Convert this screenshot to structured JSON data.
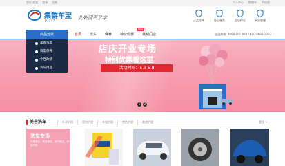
{
  "topbar": {
    "links_left": [
      "您好,欢迎",
      "登录",
      "注册"
    ],
    "links_right": [
      "个人中心",
      "购物车",
      "手机版"
    ]
  },
  "header": {
    "brand": "集群车宝",
    "brand_sub": "JIQUN",
    "slogan": "此处留不了字",
    "features": [
      "正品保障",
      "贴心服务",
      "品质保证",
      "安全管理"
    ]
  },
  "nav": {
    "category_title": "商品分类",
    "items": [
      "首页",
      "洗车",
      "保养",
      "特价优惠",
      "最新门店"
    ],
    "hot_badge": "NEW",
    "phone": "全国热线: 4008-001-888 / 400-8888-1002"
  },
  "side_categories": [
    "美容洗车",
    "日常保养",
    "个性改装",
    "汽车用品"
  ],
  "banner": {
    "title": "店庆开业专场",
    "subtitle": "特别优惠看这里",
    "time_label": "活动时间：5.3-5.8",
    "dots": [
      "1",
      "2"
    ]
  },
  "section": {
    "title": "美容洗车",
    "tabs": [
      "外表护理",
      "室内护理",
      "车轮护理",
      "特色护理",
      "其他护理"
    ],
    "more": "更多 >",
    "promo_title": "洗车专场",
    "promo_text": "外表清洁、底盘清洗、室内清洁、精致内饰"
  },
  "colors": {
    "brand": "#1777c7",
    "accent": "#e0262e",
    "banner": "#f6a0b2",
    "sidebar": "#1c2a46"
  }
}
